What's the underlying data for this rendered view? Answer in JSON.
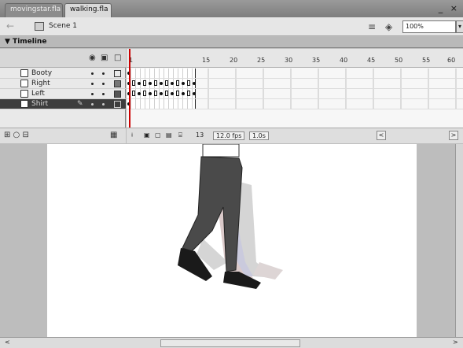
{
  "doc_tabs": [
    {
      "label": "movingstar.fla",
      "active": false
    },
    {
      "label": "walking.fla",
      "active": true
    }
  ],
  "window_controls": "_ ×",
  "scene_bar": {
    "scene_label": "Scene 1",
    "zoom_value": "100%",
    "zoom_arrow": "▾"
  },
  "timeline": {
    "title": "▼ Timeline",
    "ruler_ticks": [
      "1",
      "15",
      "20",
      "25",
      "30",
      "35",
      "40",
      "45",
      "50",
      "55",
      "60"
    ],
    "layers": [
      {
        "name": "Booty",
        "selected": false
      },
      {
        "name": "Right",
        "selected": false
      },
      {
        "name": "Left",
        "selected": false
      },
      {
        "name": "Shirt",
        "selected": true
      }
    ],
    "status": {
      "current_frame": "13",
      "fps": "12.0 fps",
      "elapsed": "1.0s"
    }
  },
  "icons": {
    "back": "←",
    "eye": "◉",
    "lock": "▣",
    "outline": "□",
    "pencil": "✎",
    "trash": "▦",
    "add_layer": "⊞ ○ ⊟",
    "edit_scene": "≡",
    "edit_symbol": "◈",
    "scroll_left": "<",
    "scroll_right": ">",
    "scroll_step_left": "<",
    "scroll_step_right": ">"
  },
  "colors": {
    "pants": "#4a4a4a",
    "shoes": "#1a1a1a",
    "ghost": "#cfcfcf"
  }
}
